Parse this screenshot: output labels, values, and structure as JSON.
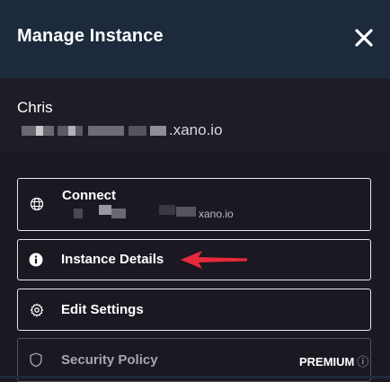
{
  "header": {
    "title": "Manage Instance",
    "close_icon": "close-icon"
  },
  "account": {
    "name": "Chris",
    "domain_suffix": ".xano.io"
  },
  "menu": {
    "connect": {
      "label": "Connect",
      "icon": "globe-icon",
      "domain_suffix": "xano.io"
    },
    "instance_details": {
      "label": "Instance Details",
      "icon": "info-icon"
    },
    "edit_settings": {
      "label": "Edit Settings",
      "icon": "gear-icon"
    },
    "security_policy": {
      "label": "Security Policy",
      "icon": "shield-icon",
      "badge": "PREMIUM",
      "badge_icon": "ⓘ"
    }
  },
  "colors": {
    "header_bg": "#1c2a3c",
    "body_bg": "#1b1821",
    "annotation_arrow": "#e8293c"
  }
}
